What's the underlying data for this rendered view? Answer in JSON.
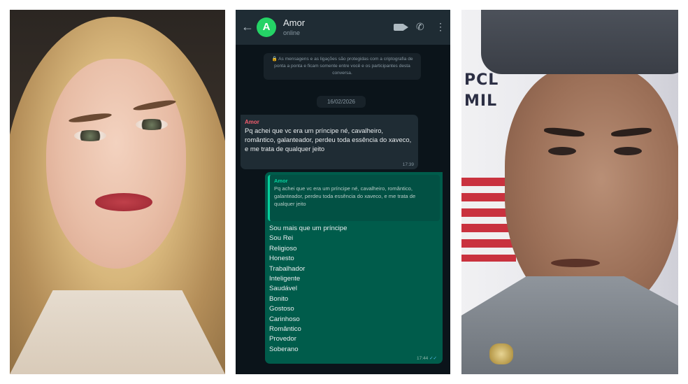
{
  "chat": {
    "contact_initial": "A",
    "contact_name": "Amor",
    "contact_status": "online",
    "back_icon": "arrow-left-icon",
    "header_icons": [
      "video-call-icon",
      "phone-icon",
      "menu-dots-icon"
    ],
    "encryption_notice": "As mensagens e as ligações são protegidas com a criptografia de ponta a ponta e ficam somente entre você e os participantes desta conversa.",
    "date_chip": "16/02/2026",
    "incoming": {
      "sender": "Amor",
      "text": "Pq achei que vc era um príncipe né, cavalheiro, romântico, galanteador, perdeu toda essência do xaveco, e me trata de qualquer jeito",
      "time": "17:39"
    },
    "outgoing": {
      "quote_sender": "Amor",
      "quote_text": "Pq achei que vc era um príncipe né, cavalheiro, romântico, galanteador, perdeu toda essência do xaveco, e me trata de qualquer jeito",
      "lines": [
        "Sou mais que um príncipe",
        "Sou Rei",
        "Religioso",
        "Honesto",
        "Trabalhador",
        "Inteligente",
        "Saudável",
        "Bonito",
        "Gostoso",
        "Carinhoso",
        "Romântico",
        "Provedor",
        "Soberano"
      ],
      "time": "17:44",
      "ticks": "✓✓"
    },
    "colors": {
      "background": "#0b141a",
      "header": "#1f2c34",
      "incoming_bubble": "#1f2c34",
      "outgoing_bubble": "#005c4b",
      "sender_name": "#f15c6d",
      "accent": "#25d366"
    }
  },
  "photos": {
    "right_wall_text": [
      "PCL",
      "MIL"
    ]
  }
}
